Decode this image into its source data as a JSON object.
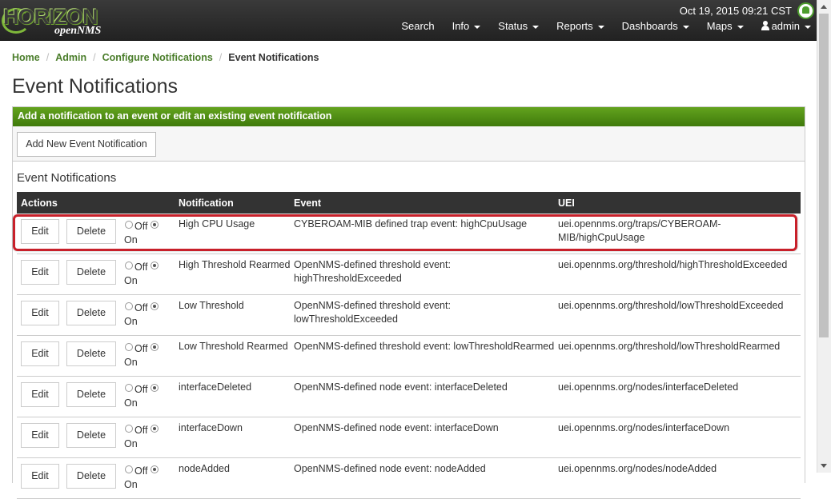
{
  "app": {
    "logo_main": "HORIZON",
    "logo_sub": "openNMS"
  },
  "header": {
    "datetime": "Oct 19, 2015 09:21 CST",
    "menu": [
      "Search",
      "Info",
      "Status",
      "Reports",
      "Dashboards",
      "Maps"
    ],
    "user": "admin"
  },
  "breadcrumb": {
    "items": [
      "Home",
      "Admin",
      "Configure Notifications"
    ],
    "current": "Event Notifications"
  },
  "page": {
    "title": "Event Notifications",
    "panel_heading": "Add a notification to an event or edit an existing event notification",
    "add_button": "Add New Event Notification",
    "section_title": "Event Notifications"
  },
  "table": {
    "columns": [
      "Actions",
      "Notification",
      "Event",
      "UEI"
    ],
    "edit_label": "Edit",
    "delete_label": "Delete",
    "off_label": "Off",
    "on_label": "On",
    "rows": [
      {
        "notification": "High CPU Usage",
        "event": "CYBEROAM-MIB defined trap event: highCpuUsage",
        "uei": "uei.opennms.org/traps/CYBEROAM-MIB/highCpuUsage",
        "state": "on"
      },
      {
        "notification": "High Threshold Rearmed",
        "event": "OpenNMS-defined threshold event: highThresholdExceeded",
        "uei": "uei.opennms.org/threshold/highThresholdExceeded",
        "state": "on"
      },
      {
        "notification": "Low Threshold",
        "event": "OpenNMS-defined threshold event: lowThresholdExceeded",
        "uei": "uei.opennms.org/threshold/lowThresholdExceeded",
        "state": "on"
      },
      {
        "notification": "Low Threshold Rearmed",
        "event": "OpenNMS-defined threshold event: lowThresholdRearmed",
        "uei": "uei.opennms.org/threshold/lowThresholdRearmed",
        "state": "on"
      },
      {
        "notification": "interfaceDeleted",
        "event": "OpenNMS-defined node event: interfaceDeleted",
        "uei": "uei.opennms.org/nodes/interfaceDeleted",
        "state": "on"
      },
      {
        "notification": "interfaceDown",
        "event": "OpenNMS-defined node event: interfaceDown",
        "uei": "uei.opennms.org/nodes/interfaceDown",
        "state": "on"
      },
      {
        "notification": "nodeAdded",
        "event": "OpenNMS-defined node event: nodeAdded",
        "uei": "uei.opennms.org/nodes/nodeAdded",
        "state": "on"
      }
    ]
  },
  "colors": {
    "navbar": "#2b2b2b",
    "panel_heading": "#4f8d14",
    "link": "#4a7d2a",
    "highlight": "#c8202a"
  }
}
